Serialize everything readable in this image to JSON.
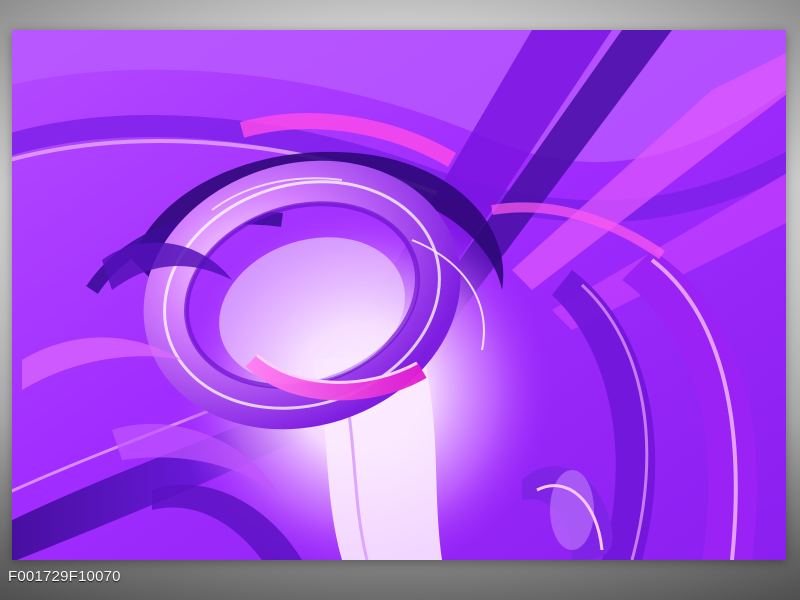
{
  "artwork": {
    "palette": {
      "deep": "#5b0fc2",
      "primary": "#a12cff",
      "magenta": "#e04dff",
      "pink": "#ff3fe6",
      "glow": "#ffffff"
    }
  },
  "caption": {
    "product_code": "F001729F10070"
  }
}
